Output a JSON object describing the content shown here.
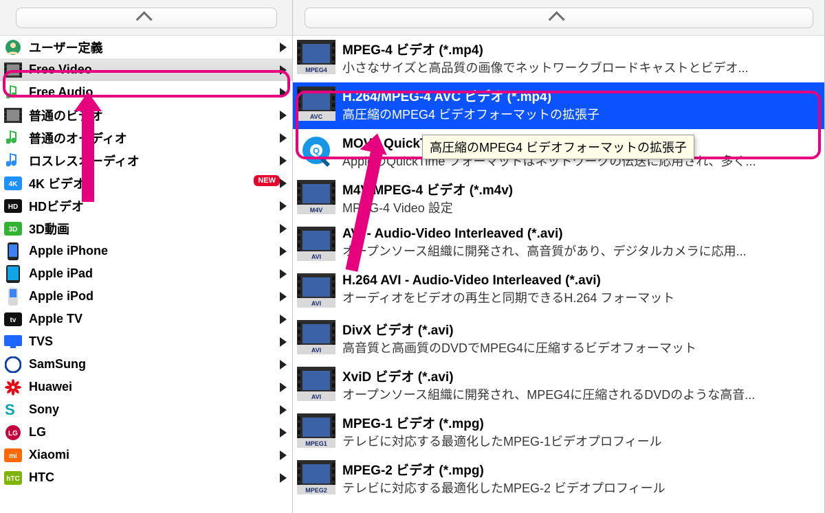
{
  "sidebar": {
    "items": [
      {
        "label": "ユーザー定義",
        "icon": "user-icon",
        "badge": null
      },
      {
        "label": "Free Video",
        "icon": "film-icon",
        "badge": null,
        "selected": true
      },
      {
        "label": "Free Audio",
        "icon": "note-green-icon",
        "badge": null
      },
      {
        "label": "普通のビデオ",
        "icon": "film-dark-icon",
        "badge": null
      },
      {
        "label": "普通のオーディオ",
        "icon": "note-green-icon",
        "badge": null
      },
      {
        "label": "ロスレスオーディオ",
        "icon": "note-blue-icon",
        "badge": null
      },
      {
        "label": "4K ビデオ",
        "icon": "4k-icon",
        "badge": "NEW"
      },
      {
        "label": "HDビデオ",
        "icon": "hd-icon",
        "badge": null
      },
      {
        "label": "3D動画",
        "icon": "3d-icon",
        "badge": null
      },
      {
        "label": "Apple iPhone",
        "icon": "iphone-icon",
        "badge": null
      },
      {
        "label": "Apple iPad",
        "icon": "ipad-icon",
        "badge": null
      },
      {
        "label": "Apple iPod",
        "icon": "ipod-icon",
        "badge": null
      },
      {
        "label": "Apple TV",
        "icon": "appletv-icon",
        "badge": null
      },
      {
        "label": "TVS",
        "icon": "tv-icon",
        "badge": null
      },
      {
        "label": "SamSung",
        "icon": "samsung-icon",
        "badge": null
      },
      {
        "label": "Huawei",
        "icon": "huawei-icon",
        "badge": null
      },
      {
        "label": "Sony",
        "icon": "sony-icon",
        "badge": null
      },
      {
        "label": "LG",
        "icon": "lg-icon",
        "badge": null
      },
      {
        "label": "Xiaomi",
        "icon": "xiaomi-icon",
        "badge": null
      },
      {
        "label": "HTC",
        "icon": "htc-icon",
        "badge": null
      }
    ]
  },
  "formats": {
    "items": [
      {
        "title": "MPEG-4 ビデオ (*.mp4)",
        "desc": "小さなサイズと高品質の画像でネットワークブロードキャストとビデオ...",
        "thumb": "mpeg4",
        "selected": false
      },
      {
        "title": "H.264/MPEG-4 AVC ビデオ (*.mp4)",
        "desc": "高圧縮のMPEG4 ビデオフォーマットの拡張子",
        "thumb": "avc",
        "selected": true
      },
      {
        "title": "MOV - QuickTime ビデオ (*.mov)",
        "desc": "AppleのQuickTime フォーマットはネットワークの伝送に応用され、多く...",
        "thumb": "qt",
        "selected": false
      },
      {
        "title": "M4V MPEG-4 ビデオ (*.m4v)",
        "desc": "MPEG-4 Video 設定",
        "thumb": "m4v",
        "selected": false
      },
      {
        "title": "AVI - Audio-Video Interleaved (*.avi)",
        "desc": "オープンソース組織に開発され、高音質があり、デジタルカメラに応用...",
        "thumb": "avi",
        "selected": false
      },
      {
        "title": "H.264 AVI - Audio-Video Interleaved (*.avi)",
        "desc": "オーディオをビデオの再生と同期できるH.264 フォーマット",
        "thumb": "avi",
        "selected": false
      },
      {
        "title": "DivX ビデオ (*.avi)",
        "desc": "高音質と高画質のDVDでMPEG4に圧縮するビデオフォーマット",
        "thumb": "avi",
        "selected": false
      },
      {
        "title": "XviD ビデオ (*.avi)",
        "desc": "オープンソース組織に開発され、MPEG4に圧縮されるDVDのような高音...",
        "thumb": "avi",
        "selected": false
      },
      {
        "title": "MPEG-1 ビデオ (*.mpg)",
        "desc": "テレビに対応する最適化したMPEG-1ビデオプロフィール",
        "thumb": "mpeg1",
        "selected": false
      },
      {
        "title": "MPEG-2 ビデオ (*.mpg)",
        "desc": "テレビに対応する最適化したMPEG-2 ビデオプロフィール",
        "thumb": "mpeg2",
        "selected": false
      }
    ]
  },
  "tooltip": "高圧縮のMPEG4 ビデオフォーマットの拡張子",
  "badge_new": "NEW"
}
